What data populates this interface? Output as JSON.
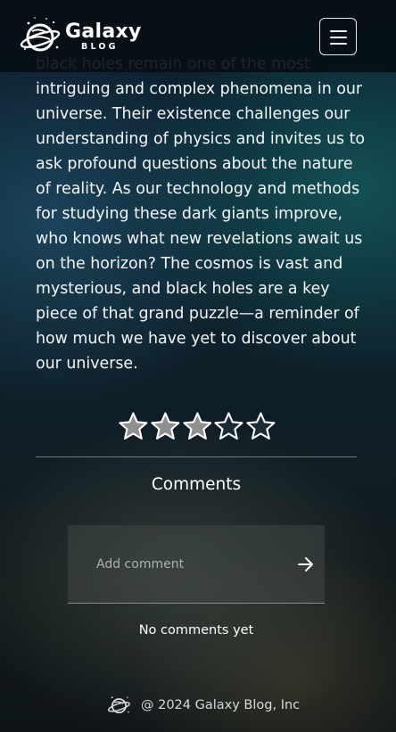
{
  "header": {
    "logo_title": "Galaxy",
    "logo_subtitle": "BLOG",
    "menu_icon": "hamburger-menu-icon"
  },
  "article": {
    "text": "black holes remain one of the most intriguing and complex phenomena in our universe. Their existence challenges our understanding of physics and invites us to ask profound questions about the nature of reality. As our technology and methods for studying these dark giants improve, who knows what new revelations await us on the horizon? The cosmos is vast and mysterious, and black holes are a key piece of that grand puzzle—a reminder of how much we have yet to discover about our universe."
  },
  "rating": {
    "value": 3,
    "max": 5,
    "filled_color": "#8f8f8f",
    "empty_color": "#1c2c36"
  },
  "comments": {
    "title": "Comments",
    "input_placeholder": "Add comment",
    "send_icon": "arrow-right-icon",
    "empty_message": "No comments yet"
  },
  "footer": {
    "text": "@ 2024 Galaxy Blog, Inc",
    "icon": "planet-logo-icon"
  }
}
